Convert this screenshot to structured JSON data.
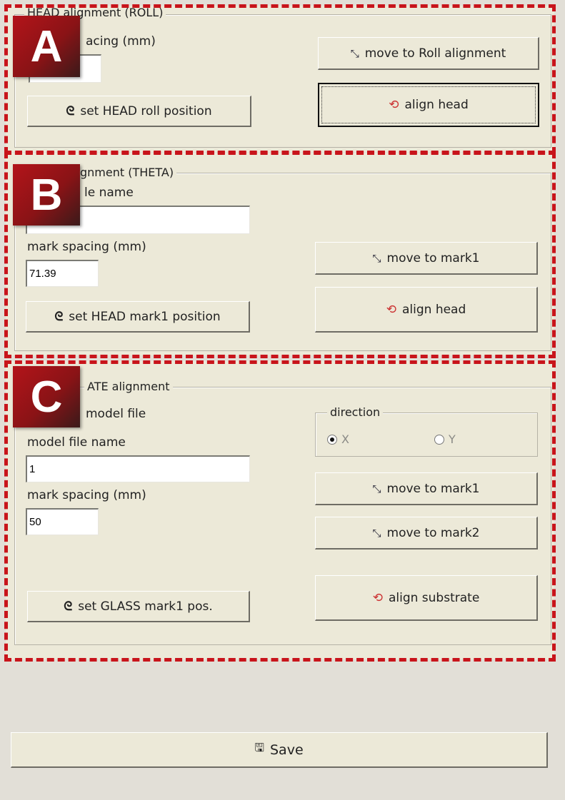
{
  "colors": {
    "panel": "#ece9d8",
    "highlight": "#c8141b"
  },
  "badges": [
    "A",
    "B",
    "C"
  ],
  "section_a": {
    "title": "HEAD alignment (ROLL)",
    "spacing_label_visible": "acing (mm)",
    "spacing_value": "",
    "move_button": "move to Roll alignment",
    "align_button": "align head",
    "set_button": "set HEAD roll position"
  },
  "section_b": {
    "title_visible": "gnment (THETA)",
    "file_label_visible": "le name",
    "file_value": "",
    "spacing_label": "mark spacing (mm)",
    "spacing_value": "71.39",
    "move_button": "move to mark1",
    "align_button": "align head",
    "set_button": "set HEAD mark1 position"
  },
  "section_c": {
    "title_visible": "ATE alignment",
    "checkbox_label_visible": "model file",
    "file_label": "model file name",
    "file_value": "1",
    "spacing_label": "mark spacing (mm)",
    "spacing_value": "50",
    "direction": {
      "title": "direction",
      "options": [
        "X",
        "Y"
      ],
      "selected": "X"
    },
    "move1_button": "move to mark1",
    "move2_button": "move to mark2",
    "align_button": "align substrate",
    "set_button": "set GLASS mark1 pos."
  },
  "save_button": "Save",
  "icons": {
    "move": "move-arrows-icon",
    "align": "align-target-icon",
    "set": "set-position-icon",
    "save": "save-icon"
  }
}
